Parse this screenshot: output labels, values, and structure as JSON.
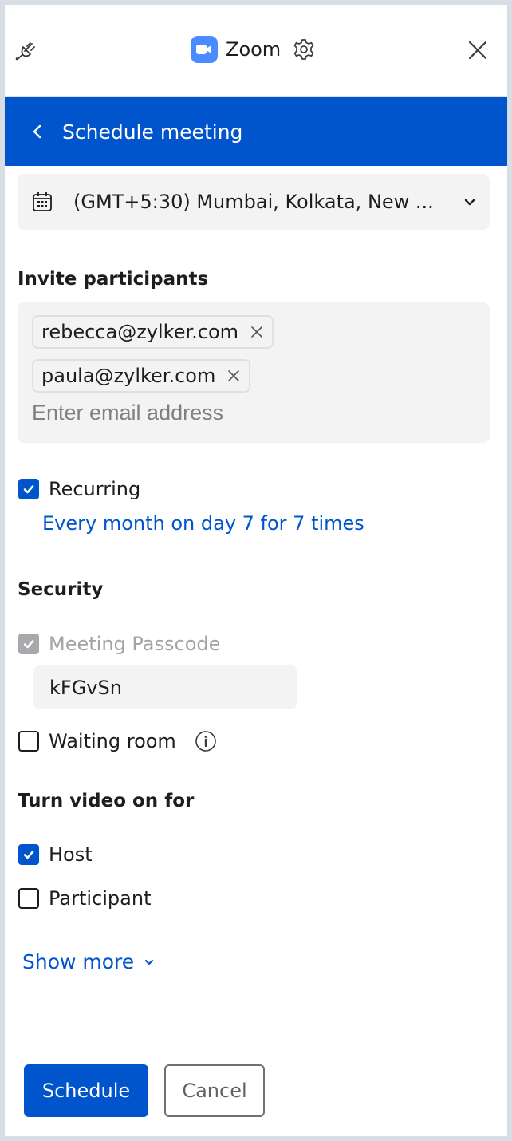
{
  "header": {
    "app_title": "Zoom",
    "icons": {
      "left": "plug-icon",
      "logo": "zoom-video-logo",
      "settings": "gear-icon",
      "close": "close-icon"
    }
  },
  "nav": {
    "back_icon": "chevron-left-icon",
    "title": "Schedule meeting"
  },
  "timezone": {
    "icon": "calendar-icon",
    "selected": "(GMT+5:30) Mumbai, Kolkata, New ...",
    "dropdown_icon": "chevron-down-icon"
  },
  "invite": {
    "label": "Invite participants",
    "participants": [
      {
        "email": "rebecca@zylker.com"
      },
      {
        "email": "paula@zylker.com"
      }
    ],
    "input_value": "",
    "placeholder": "Enter email address"
  },
  "recurring": {
    "label": "Recurring",
    "checked": true,
    "summary": "Every month on day 7 for 7 times"
  },
  "security": {
    "label": "Security",
    "passcode": {
      "label": "Meeting Passcode",
      "checked": true,
      "disabled": true,
      "value": "kFGvSn"
    },
    "waiting_room": {
      "label": "Waiting room",
      "checked": false,
      "info_icon": "info-icon"
    }
  },
  "video": {
    "label": "Turn video on for",
    "options": [
      {
        "label": "Host",
        "checked": true
      },
      {
        "label": "Participant",
        "checked": false
      }
    ]
  },
  "show_more": {
    "label": "Show more",
    "icon": "chevron-down-icon"
  },
  "actions": {
    "schedule_label": "Schedule",
    "cancel_label": "Cancel"
  },
  "colors": {
    "primary": "#0055cc",
    "zoom_logo": "#4a8cff",
    "field_bg": "#f3f3f3",
    "frame": "#d8dee4"
  }
}
